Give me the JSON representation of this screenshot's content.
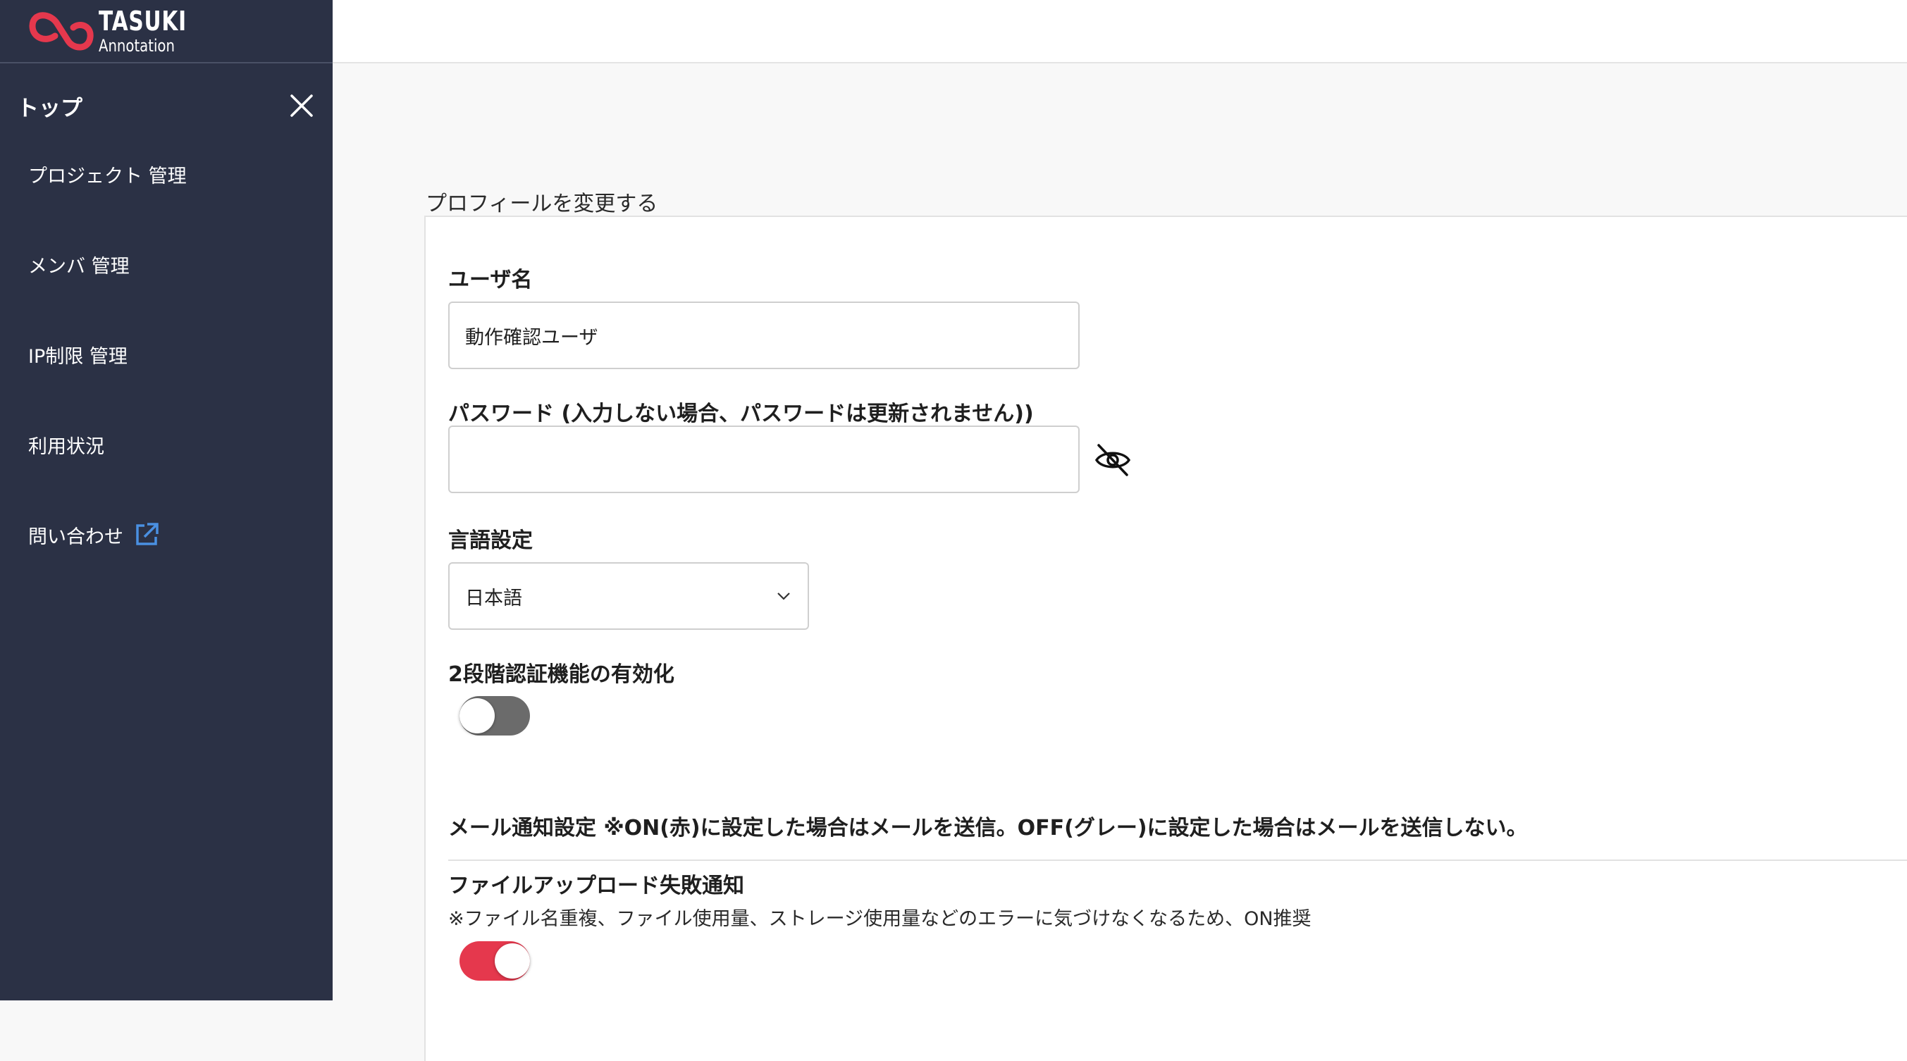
{
  "logo": {
    "line1": "TASUKI",
    "line2": "Annotation",
    "brand_color": "#e5384d"
  },
  "sidebar": {
    "title": "トップ",
    "items": [
      {
        "label": "プロジェクト 管理"
      },
      {
        "label": "メンバ 管理"
      },
      {
        "label": "IP制限 管理"
      },
      {
        "label": "利用状況"
      },
      {
        "label": "問い合わせ",
        "icon": "external-link-icon"
      }
    ],
    "bg_color": "#2b3145"
  },
  "page": {
    "section_title": "プロフィールを変更する"
  },
  "form": {
    "username": {
      "label": "ユーザ名",
      "value": "動作確認ユーザ"
    },
    "password": {
      "label": "パスワード (入力しない場合、パスワードは更新されません))",
      "value": "",
      "toggle_icon": "eye-off-icon"
    },
    "language": {
      "label": "言語設定",
      "selected": "日本語"
    },
    "two_factor": {
      "label": "2段階認証機能の有効化",
      "enabled": false
    },
    "mail_notification": {
      "label": "メール通知設定 ※ON(赤)に設定した場合はメールを送信。OFF(グレー)に設定した場合はメールを送信しない。"
    },
    "upload_failure": {
      "label": "ファイルアップロード失敗通知",
      "note": "※ファイル名重複、ファイル使用量、ストレージ使用量などのエラーに気づけなくなるため、ON推奨",
      "enabled": true
    }
  },
  "colors": {
    "toggle_on": "#e5384d",
    "toggle_off": "#6b6b6b",
    "link_icon": "#4a90e2"
  }
}
